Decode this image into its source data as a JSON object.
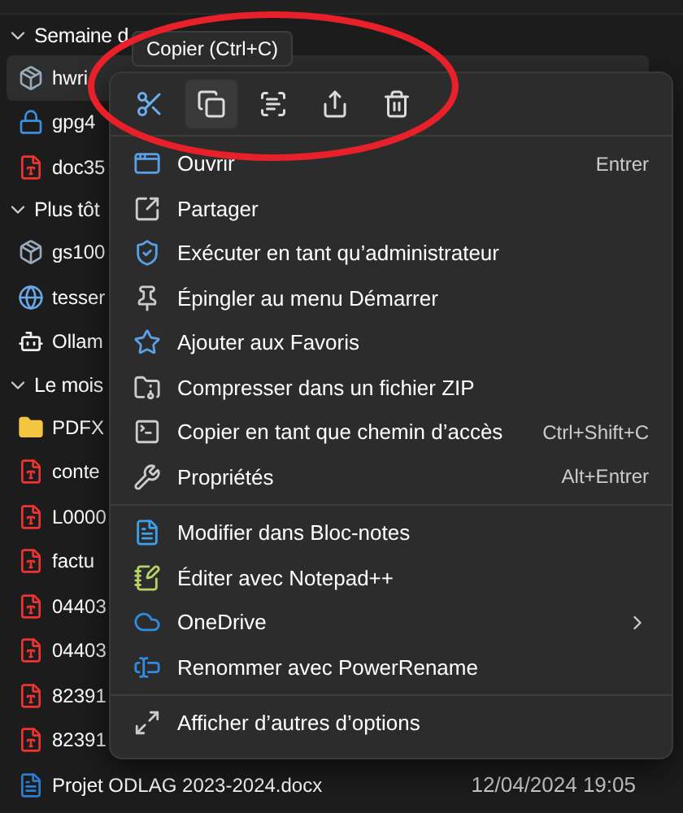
{
  "file_list": {
    "groups": [
      {
        "label": "Semaine d",
        "expanded": true,
        "files": [
          {
            "name": "hwri",
            "kind": "installer",
            "selected": true
          },
          {
            "name": "gpg4",
            "kind": "lock",
            "selected": false
          },
          {
            "name": "doc35",
            "kind": "pdf",
            "selected": false
          }
        ]
      },
      {
        "label": "Plus tôt",
        "expanded": true,
        "files": [
          {
            "name": "gs100",
            "kind": "installer",
            "selected": false
          },
          {
            "name": "tesser",
            "kind": "globe",
            "selected": false
          },
          {
            "name": "Ollam",
            "kind": "app",
            "selected": false
          }
        ]
      },
      {
        "label": "Le mois",
        "expanded": true,
        "files": [
          {
            "name": "PDFX",
            "kind": "folder",
            "selected": false
          },
          {
            "name": "conte",
            "kind": "pdf",
            "selected": false
          },
          {
            "name": "L0000",
            "kind": "pdf",
            "selected": false
          },
          {
            "name": "factu",
            "kind": "pdf",
            "selected": false
          },
          {
            "name": "04403",
            "kind": "pdf",
            "selected": false
          },
          {
            "name": "04403",
            "kind": "pdf",
            "selected": false
          },
          {
            "name": "82391",
            "kind": "pdf",
            "selected": false
          },
          {
            "name": "82391",
            "kind": "pdf",
            "selected": false
          },
          {
            "name": "Projet ODLAG 2023-2024.docx",
            "kind": "word",
            "selected": false,
            "date": "12/04/2024 19:05"
          }
        ]
      }
    ]
  },
  "context_menu": {
    "tooltip": "Copier (Ctrl+C)",
    "toolbar": [
      {
        "hovered": false
      },
      {
        "hovered": true
      },
      {
        "hovered": false
      },
      {
        "hovered": false
      },
      {
        "hovered": false
      }
    ],
    "sections": [
      [
        {
          "label": "Ouvrir",
          "shortcut": "Entrer"
        },
        {
          "label": "Partager"
        },
        {
          "label": "Exécuter en tant qu’administrateur"
        },
        {
          "label": "Épingler au menu Démarrer"
        },
        {
          "label": "Ajouter aux Favoris"
        },
        {
          "label": "Compresser dans un fichier ZIP"
        },
        {
          "label": "Copier en tant que chemin d’accès",
          "shortcut": "Ctrl+Shift+C"
        },
        {
          "label": "Propriétés",
          "shortcut": "Alt+Entrer"
        }
      ],
      [
        {
          "label": "Modifier dans Bloc-notes"
        },
        {
          "label": "Éditer avec Notepad++"
        },
        {
          "label": "OneDrive",
          "submenu": true
        },
        {
          "label": "Renommer avec PowerRename"
        }
      ],
      [
        {
          "label": "Afficher d’autres d’options"
        }
      ]
    ]
  },
  "annotation": {
    "kind": "ellipse",
    "color": "#e8202a"
  }
}
